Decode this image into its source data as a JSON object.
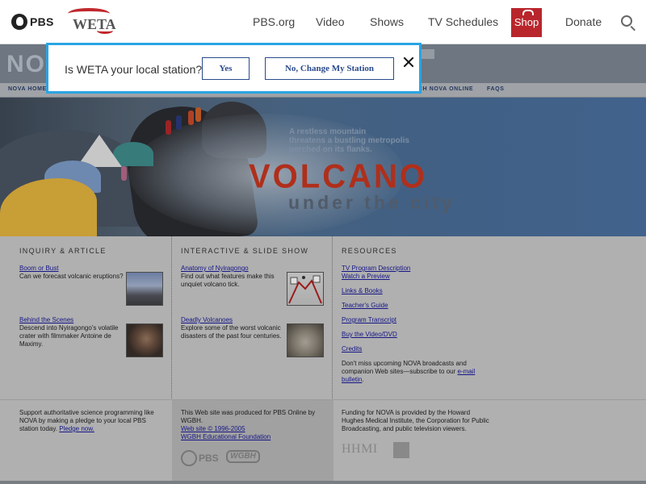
{
  "topbar": {
    "pbs_logo": "PBS",
    "station_logo": "WETA",
    "nav": [
      "PBS.org",
      "Video",
      "Shows",
      "TV Schedules",
      "Shop",
      "Donate"
    ],
    "icons": [
      "pbs-head-icon",
      "search-icon",
      "gift-icon"
    ]
  },
  "popup": {
    "question": "Is WETA your local station?",
    "yes_label": "Yes",
    "change_label": "No, Change My Station",
    "close_icon": "close-icon"
  },
  "nova": {
    "wordmark": "NOV",
    "nav_left": "NOVA HOME",
    "nav_mid": "TCH NOVA ONLINE",
    "nav_faq": "FAQS"
  },
  "hero": {
    "tagline": "A restless mountain\nthreatens a bustling metropolis\nperched on its flanks.",
    "title": "VOLCANO",
    "subtitle": "under the city"
  },
  "columns": {
    "inquiry": {
      "title": "INQUIRY & ARTICLE",
      "items": [
        {
          "link": "Boom or Bust",
          "desc": "Can we forecast volcanic eruptions?"
        },
        {
          "link": "Behind the Scenes",
          "desc": "Descend into Nyiragongo's volatile crater with filmmaker Antoine de Maximy."
        }
      ]
    },
    "interactive": {
      "title": "INTERACTIVE & SLIDE SHOW",
      "items": [
        {
          "link": "Anatomy of Nyiragongo",
          "desc": "Find out what features make this unquiet volcano tick."
        },
        {
          "link": "Deadly Volcanoes",
          "desc": "Explore some of the worst volcanic disasters of the past four centuries."
        }
      ]
    },
    "resources": {
      "title": "RESOURCES",
      "links": [
        "TV Program Description",
        "Watch a Preview",
        "Links & Books",
        "Teacher's Guide",
        "Program Transcript",
        "Buy the Video/DVD",
        "Credits"
      ],
      "note_pre": "Don't miss upcoming NOVA broadcasts and companion Web sites—subscribe to our ",
      "note_link": "e-mail bulletin",
      "note_post": "."
    }
  },
  "footer": {
    "left_text": "Support authoritative science programming like NOVA by making a pledge to your local PBS station today. ",
    "left_link": "Pledge now.",
    "mid_text": "This Web site was produced for PBS Online by WGBH.",
    "mid_link1": "Web site © 1996-2005",
    "mid_link2": "WGBH Educational Foundation",
    "pbs_logo": "PBS",
    "wgbh_logo": "WGBH",
    "right_text": "Funding for NOVA is provided by the Howard Hughes Medical Institute, the Corporation for Public Broadcasting, and public television viewers.",
    "hhmi_logo": "HHMI"
  },
  "colors": {
    "popup_border": "#2aa4e4",
    "shop_bg": "#b8262c",
    "volcano_red": "#c8361f",
    "link": "#1a1a9a"
  }
}
